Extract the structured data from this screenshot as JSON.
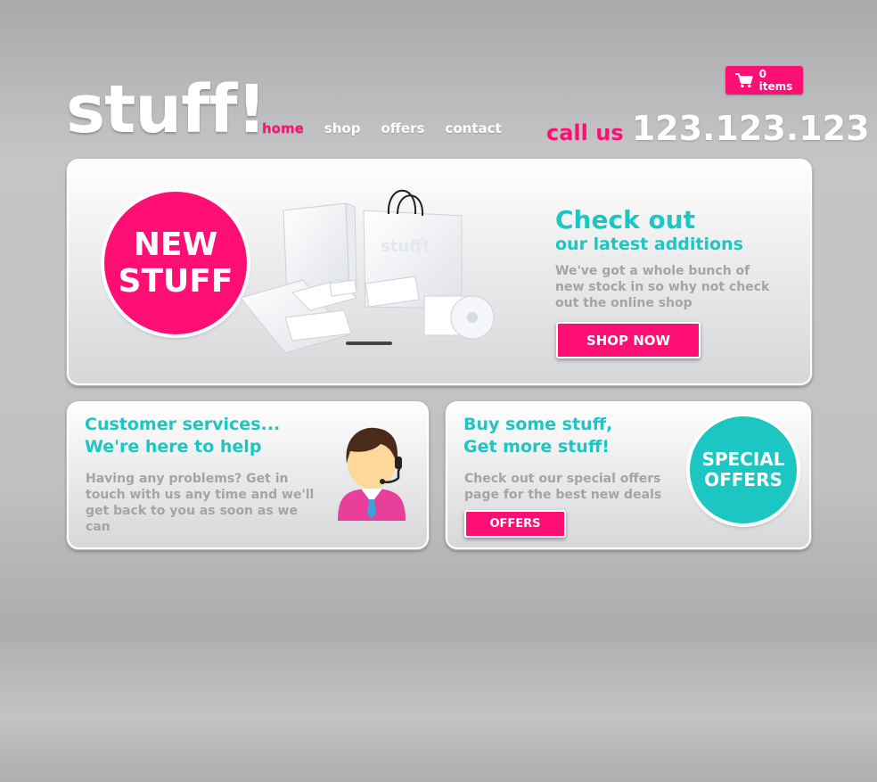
{
  "brand": {
    "logo": "stuff!"
  },
  "nav": {
    "items": [
      {
        "label": "home",
        "active": true
      },
      {
        "label": "shop",
        "active": false
      },
      {
        "label": "offers",
        "active": false
      },
      {
        "label": "contact",
        "active": false
      }
    ]
  },
  "cart": {
    "label": "0 items",
    "icon": "cart-icon"
  },
  "call": {
    "label": "call us",
    "number": "123.123.123"
  },
  "hero": {
    "badge_line1": "NEW",
    "badge_line2": "STUFF",
    "title": "Check out",
    "subtitle": "our latest additions",
    "description": "We've got a whole bunch of new stock in so why not check out the online shop",
    "button": "SHOP NOW",
    "product_brand": "stuff!"
  },
  "customer_services": {
    "title_line1": "Customer services...",
    "title_line2": "We're here to help",
    "description": "Having any problems? Get in touch with us any time and we'll get back to you as soon as we can"
  },
  "offers": {
    "title_line1": "Buy some stuff,",
    "title_line2": "Get more stuff!",
    "description": "Check out our special offers page for the best new deals",
    "button": "OFFERS",
    "badge_line1": "SPECIAL",
    "badge_line2": "OFFERS"
  },
  "colors": {
    "pink": "#ff0f74",
    "teal": "#1cc6c2",
    "gray_text": "#a3a4a6"
  }
}
